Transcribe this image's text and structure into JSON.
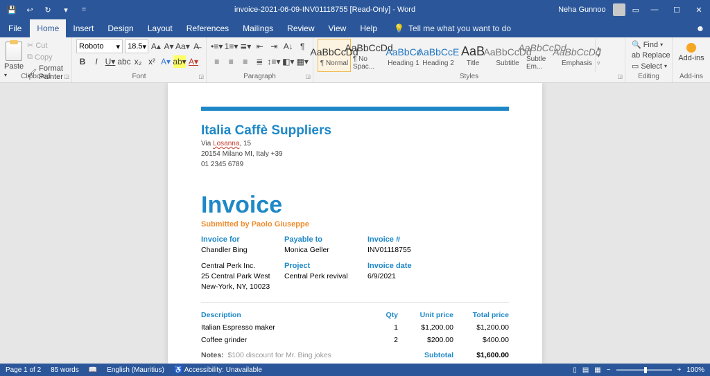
{
  "titlebar": {
    "doc_title": "invoice-2021-06-09-INV01118755 [Read-Only]  -  Word",
    "user": "Neha Gunnoo"
  },
  "menu": {
    "file": "File",
    "home": "Home",
    "insert": "Insert",
    "design": "Design",
    "layout": "Layout",
    "references": "References",
    "mailings": "Mailings",
    "review": "Review",
    "view": "View",
    "help": "Help",
    "tellme": "Tell me what you want to do"
  },
  "ribbon": {
    "clipboard": {
      "paste": "Paste",
      "cut": "Cut",
      "copy": "Copy",
      "format_painter": "Format Painter",
      "label": "Clipboard"
    },
    "font": {
      "name": "Roboto",
      "size": "18.5",
      "label": "Font"
    },
    "paragraph": {
      "label": "Paragraph"
    },
    "styles": {
      "label": "Styles",
      "items": [
        {
          "sample": "AaBbCcDd",
          "name": "¶ Normal"
        },
        {
          "sample": "AaBbCcDd",
          "name": "¶ No Spac..."
        },
        {
          "sample": "AaBbCc",
          "name": "Heading 1"
        },
        {
          "sample": "AaBbCcE",
          "name": "Heading 2"
        },
        {
          "sample": "AaB",
          "name": "Title"
        },
        {
          "sample": "AaBbCcDd",
          "name": "Subtitle"
        },
        {
          "sample": "AaBbCcDd",
          "name": "Subtle Em..."
        },
        {
          "sample": "AaBbCcDd",
          "name": "Emphasis"
        }
      ]
    },
    "editing": {
      "find": "Find",
      "replace": "Replace",
      "select": "Select",
      "label": "Editing"
    },
    "addins": {
      "label": "Add-ins",
      "btn": "Add-ins"
    }
  },
  "doc": {
    "company": "Italia Caffè Suppliers",
    "addr1a": "Via ",
    "addr1b": "Losanna",
    "addr1c": ", 15",
    "addr2": "20154 Milano MI, Italy +39",
    "addr3": "01 2345 6789",
    "title": "Invoice",
    "submitted": "Submitted by Paolo Giuseppe",
    "labels": {
      "invoice_for": "Invoice for",
      "payable": "Payable to",
      "invoice_no": "Invoice #",
      "project": "Project",
      "invoice_date": "Invoice date"
    },
    "invoice_for_name": "Chandler Bing",
    "invoice_for_company": "Central Perk Inc.",
    "invoice_for_street": "25 Central Park West",
    "invoice_for_city": "New-York, NY, 10023",
    "payable_to": "Monica Geller",
    "project": "Central Perk revival",
    "invoice_number": "INV01118755",
    "invoice_date": "6/9/2021",
    "cols": {
      "desc": "Description",
      "qty": "Qty",
      "unit": "Unit price",
      "total": "Total price"
    },
    "rows": [
      {
        "desc": "Italian Espresso maker",
        "qty": "1",
        "unit": "$1,200.00",
        "total": "$1,200.00"
      },
      {
        "desc": "Coffee grinder",
        "qty": "2",
        "unit": "$200.00",
        "total": "$400.00"
      }
    ],
    "notes_label": "Notes:",
    "notes_text": "$100 discount for Mr. Bing jokes",
    "subtotal_label": "Subtotal",
    "subtotal": "$1,600.00"
  },
  "status": {
    "page": "Page 1 of 2",
    "words": "85 words",
    "lang": "English (Mauritius)",
    "access": "Accessibility: Unavailable",
    "zoom": "100%"
  }
}
